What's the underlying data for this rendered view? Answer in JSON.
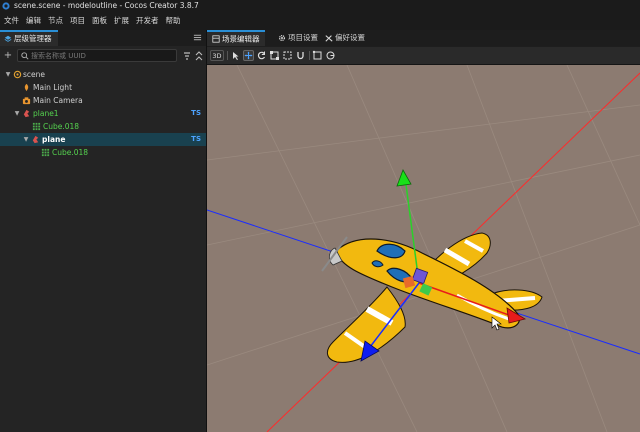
{
  "window": {
    "title": "scene.scene - modeloutline - Cocos Creator 3.8.7"
  },
  "menu": [
    "文件",
    "编辑",
    "节点",
    "项目",
    "面板",
    "扩展",
    "开发者",
    "帮助"
  ],
  "hierarchy": {
    "tab_label": "层级管理器",
    "search_placeholder": "搜索名称或 UUID",
    "nodes": [
      {
        "label": "scene",
        "icon": "scene-icon",
        "ts": ""
      },
      {
        "label": "Main Light",
        "icon": "light-icon",
        "ts": ""
      },
      {
        "label": "Main Camera",
        "icon": "camera-icon",
        "ts": ""
      },
      {
        "label": "plane1",
        "icon": "prefab-node-icon",
        "ts": "TS"
      },
      {
        "label": "Cube.018",
        "icon": "mesh-icon",
        "ts": ""
      },
      {
        "label": "plane",
        "icon": "prefab-node-icon",
        "ts": "TS"
      },
      {
        "label": "Cube.018",
        "icon": "mesh-icon",
        "ts": ""
      }
    ]
  },
  "scene_tabs": [
    {
      "label": "场景编辑器",
      "icon": "scene-editor-icon"
    },
    {
      "label": "项目设置",
      "icon": "gear-icon"
    },
    {
      "label": "偏好设置",
      "icon": "tools-icon"
    }
  ],
  "toolbar": {
    "mode_3d": "3D"
  },
  "colors": {
    "accent": "#2a8fd6",
    "viewport_bg": "#8c7b71",
    "selected_row": "#19414f",
    "prefab_green": "#55d24f",
    "ts_blue": "#4da3ff"
  }
}
